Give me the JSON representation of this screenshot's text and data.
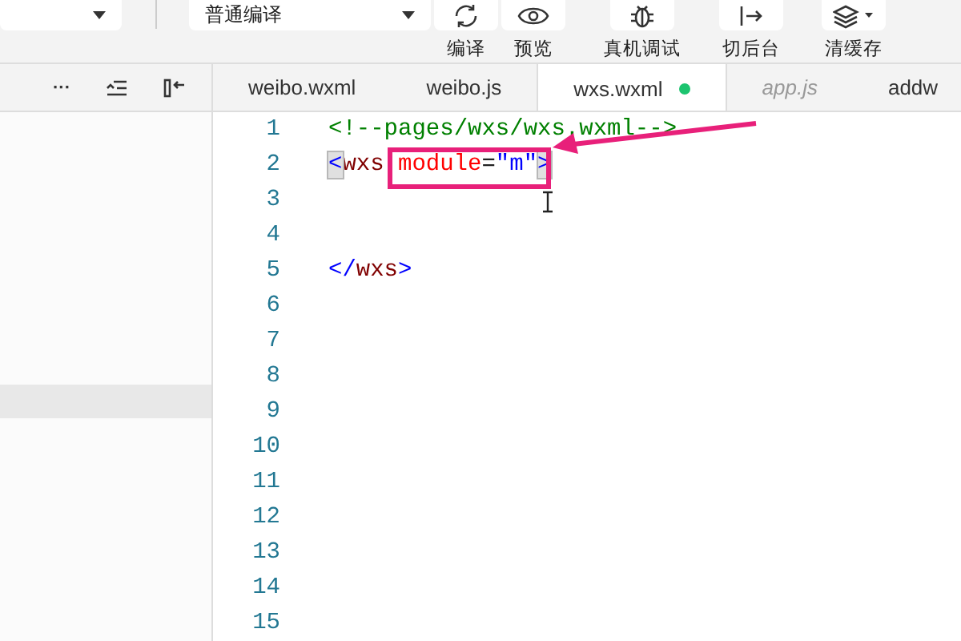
{
  "toolbar": {
    "compile_mode": {
      "value": "普通编译"
    },
    "buttons": [
      {
        "kind": "refresh",
        "label": "编译"
      },
      {
        "kind": "eye",
        "label": "预览"
      },
      {
        "kind": "bug",
        "label": "真机调试"
      },
      {
        "kind": "switch",
        "label": "切后台"
      },
      {
        "kind": "layers",
        "label": "清缓存"
      }
    ]
  },
  "sidebar_tools": [
    {
      "kind": "more",
      "label": "···"
    },
    {
      "kind": "outdent"
    },
    {
      "kind": "collapse"
    }
  ],
  "tabs": [
    {
      "label": "weibo.wxml",
      "selected": false,
      "italic": false,
      "modified": false
    },
    {
      "label": "weibo.js",
      "selected": false,
      "italic": false,
      "modified": false
    },
    {
      "label": "wxs.wxml",
      "selected": true,
      "italic": false,
      "modified": true
    },
    {
      "label": "app.js",
      "selected": false,
      "italic": true,
      "modified": false
    },
    {
      "label": "addw",
      "selected": false,
      "italic": false,
      "modified": false
    }
  ],
  "editor": {
    "lines": [
      {
        "number": "1",
        "tokens": [
          {
            "kind": "comment",
            "text": "<!--pages/wxs/wxs.wxml-->"
          }
        ]
      },
      {
        "number": "2",
        "tokens": [
          {
            "kind": "bracket",
            "text": "<",
            "matched": true
          },
          {
            "kind": "tag",
            "text": "wxs"
          },
          {
            "kind": "attr",
            "text": "module"
          },
          {
            "kind": "punct",
            "text": "="
          },
          {
            "kind": "string",
            "text": "\"m\""
          },
          {
            "kind": "bracket",
            "text": ">",
            "matched": true
          }
        ]
      },
      {
        "number": "3"
      },
      {
        "number": "4"
      },
      {
        "number": "5",
        "tokens": [
          {
            "kind": "bracket",
            "text": "</",
            "matched": false
          },
          {
            "kind": "tag",
            "text": "wxs"
          },
          {
            "kind": "bracket",
            "text": ">",
            "matched": false
          }
        ]
      },
      {
        "number": "6"
      },
      {
        "number": "7"
      },
      {
        "number": "8"
      },
      {
        "number": "9"
      },
      {
        "number": "10"
      },
      {
        "number": "11"
      },
      {
        "number": "12"
      },
      {
        "number": "13"
      },
      {
        "number": "14"
      },
      {
        "number": "15"
      }
    ]
  }
}
